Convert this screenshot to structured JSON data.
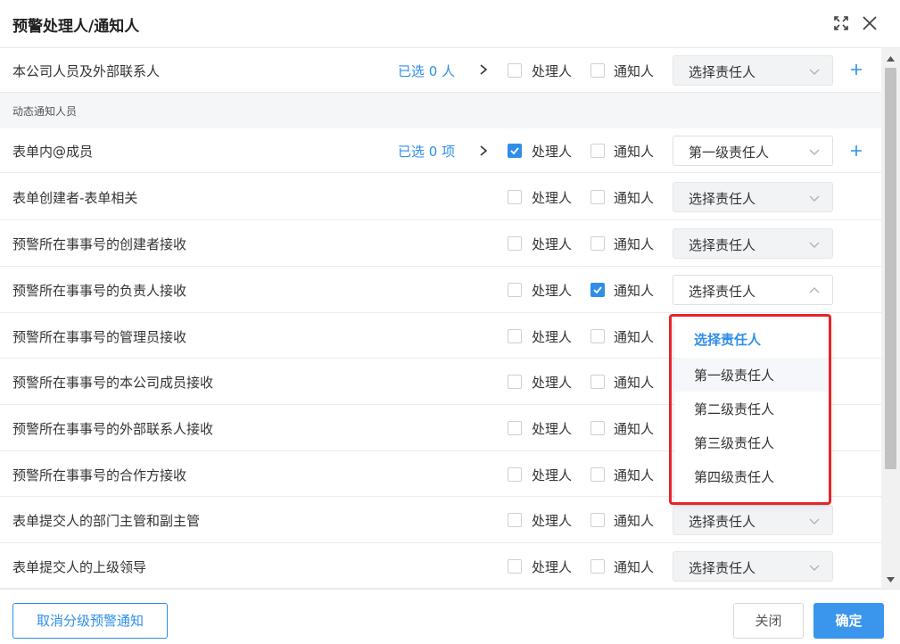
{
  "dialog": {
    "title": "预警处理人/通知人"
  },
  "top_row": {
    "label": "本公司人员及外部联系人",
    "selected_text": "已选 0 人",
    "handler_label": "处理人",
    "handler_checked": false,
    "notify_label": "通知人",
    "notify_checked": false,
    "select_value": "选择责任人"
  },
  "section": {
    "label": "动态通知人员"
  },
  "rows": [
    {
      "label": "表单内@成员",
      "selected_text": "已选 0 项",
      "handler_label": "处理人",
      "handler_checked": true,
      "notify_label": "通知人",
      "notify_checked": false,
      "select_value": "第一级责任人"
    },
    {
      "label": "表单创建者-表单相关",
      "handler_label": "处理人",
      "handler_checked": false,
      "notify_label": "通知人",
      "notify_checked": false,
      "select_value": "选择责任人"
    },
    {
      "label": "预警所在事事号的创建者接收",
      "handler_label": "处理人",
      "handler_checked": false,
      "notify_label": "通知人",
      "notify_checked": false,
      "select_value": "选择责任人"
    },
    {
      "label": "预警所在事事号的负责人接收",
      "handler_label": "处理人",
      "handler_checked": false,
      "notify_label": "通知人",
      "notify_checked": true,
      "select_value": "选择责任人"
    },
    {
      "label": "预警所在事事号的管理员接收",
      "handler_label": "处理人",
      "handler_checked": false,
      "notify_label": "通知人",
      "notify_checked": false
    },
    {
      "label": "预警所在事事号的本公司成员接收",
      "handler_label": "处理人",
      "handler_checked": false,
      "notify_label": "通知人",
      "notify_checked": false
    },
    {
      "label": "预警所在事事号的外部联系人接收",
      "handler_label": "处理人",
      "handler_checked": false,
      "notify_label": "通知人",
      "notify_checked": false
    },
    {
      "label": "预警所在事事号的合作方接收",
      "handler_label": "处理人",
      "handler_checked": false,
      "notify_label": "通知人",
      "notify_checked": false
    },
    {
      "label": "表单提交人的部门主管和副主管",
      "handler_label": "处理人",
      "handler_checked": false,
      "notify_label": "通知人",
      "notify_checked": false,
      "select_value": "选择责任人"
    },
    {
      "label": "表单提交人的上级领导",
      "handler_label": "处理人",
      "handler_checked": false,
      "notify_label": "通知人",
      "notify_checked": false,
      "select_value": "选择责任人"
    }
  ],
  "dropdown": {
    "options": [
      "选择责任人",
      "第一级责任人",
      "第二级责任人",
      "第三级责任人",
      "第四级责任人"
    ],
    "selected": "选择责任人",
    "hovered": "第一级责任人"
  },
  "footer": {
    "cancel_grading_label": "取消分级预警通知",
    "close_label": "关闭",
    "confirm_label": "确定"
  },
  "icons": {
    "expand": "fullscreen-icon",
    "close": "close-icon",
    "chevron_right": "chevron-right-icon",
    "plus": "plus-icon",
    "dropdown_arrow": "chevron-down-icon"
  },
  "colors": {
    "accent": "#2f8ee8",
    "primary_button": "#3a95ec",
    "highlight_border": "#e8242a",
    "section_bg": "#f5f6f7"
  }
}
